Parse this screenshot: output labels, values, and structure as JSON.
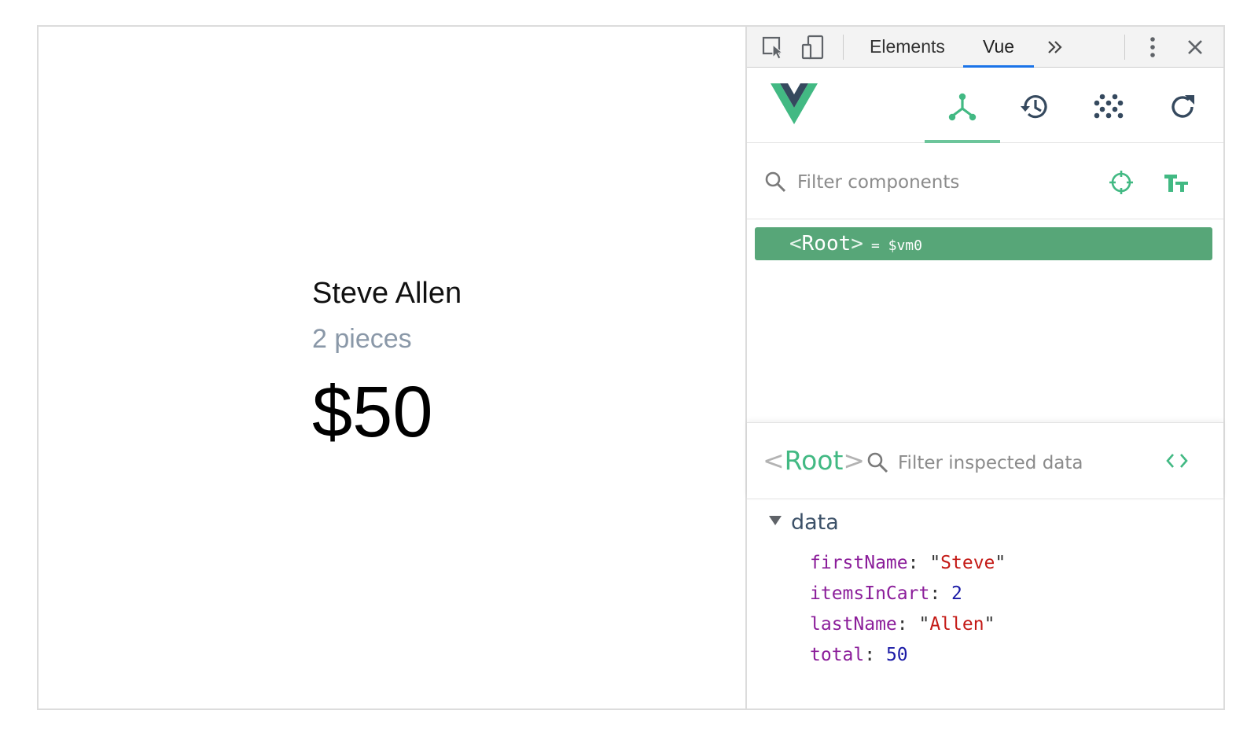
{
  "page": {
    "customer_name": "Steve Allen",
    "items_label": "2 pieces",
    "total_label": "$50"
  },
  "devtools": {
    "tabs": [
      "Elements",
      "Vue"
    ],
    "active_tab": "Vue",
    "more_tabs_icon": "double-chevron-right-icon",
    "vue_toolbar": {
      "tools": [
        "components-tree-icon",
        "history-icon",
        "vuex-dots-icon",
        "refresh-icon"
      ],
      "active_tool": "components-tree-icon",
      "accent": "#42b983"
    },
    "filter_components_placeholder": "Filter components",
    "tree": {
      "open_bracket": "<",
      "component": "Root",
      "close_bracket": ">",
      "vm_ref": "= $vm0",
      "selected_color": "#57a678"
    },
    "inspector": {
      "open_bracket": "<",
      "component": "Root",
      "close_bracket": ">",
      "filter_placeholder": "Filter inspected data"
    },
    "data_section": {
      "label": "data",
      "props": [
        {
          "key": "firstName",
          "value": "Steve",
          "type": "string"
        },
        {
          "key": "itemsInCart",
          "value": "2",
          "type": "number"
        },
        {
          "key": "lastName",
          "value": "Allen",
          "type": "string"
        },
        {
          "key": "total",
          "value": "50",
          "type": "number"
        }
      ]
    }
  }
}
